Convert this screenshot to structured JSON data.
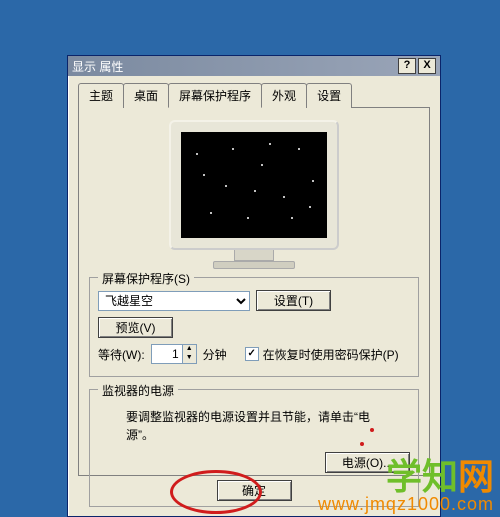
{
  "window": {
    "title": "显示 属性",
    "help_btn": "?",
    "close_btn": "X"
  },
  "tabs": {
    "items": [
      {
        "label": "主题"
      },
      {
        "label": "桌面"
      },
      {
        "label": "屏幕保护程序",
        "active": true
      },
      {
        "label": "外观"
      },
      {
        "label": "设置"
      }
    ]
  },
  "screensaver": {
    "group_label": "屏幕保护程序(S)",
    "selected": "飞越星空",
    "settings_btn": "设置(T)",
    "preview_btn": "预览(V)",
    "wait_label": "等待(W):",
    "wait_value": "1",
    "wait_unit": "分钟",
    "resume_checkbox_checked": true,
    "resume_label": "在恢复时使用密码保护(P)"
  },
  "monitor_power": {
    "group_label": "监视器的电源",
    "text_line1": "要调整监视器的电源设置并且节能，请单击“电",
    "text_line2": "源”。",
    "power_btn": "电源(O)..."
  },
  "dialog_buttons": {
    "ok": "确定"
  },
  "watermark": {
    "text_a": "学知",
    "text_b": "网",
    "url": "www.jmqz1000.com"
  }
}
